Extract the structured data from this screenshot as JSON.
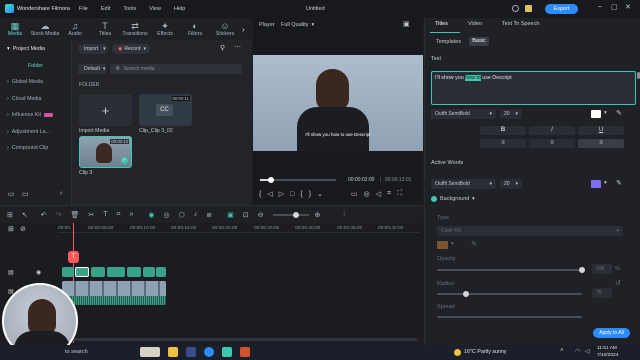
{
  "titlebar": {
    "app_name": "Wondershare Filmora",
    "menus": [
      "File",
      "Edit",
      "Tools",
      "View",
      "Help"
    ],
    "project_title": "Untitled",
    "export_label": "Export"
  },
  "top_tabs": [
    {
      "label": "Media",
      "icon": "media-icon",
      "glyph": "▦"
    },
    {
      "label": "Stock Media",
      "icon": "stock-media-icon",
      "glyph": "☁"
    },
    {
      "label": "Audio",
      "icon": "audio-icon",
      "glyph": "♫"
    },
    {
      "label": "Titles",
      "icon": "titles-icon",
      "glyph": "T"
    },
    {
      "label": "Transitions",
      "icon": "transitions-icon",
      "glyph": "⇄"
    },
    {
      "label": "Effects",
      "icon": "effects-icon",
      "glyph": "✦"
    },
    {
      "label": "Filters",
      "icon": "filters-icon",
      "glyph": "◐"
    },
    {
      "label": "Stickers",
      "icon": "stickers-icon",
      "glyph": "☺"
    }
  ],
  "sidebar": {
    "items": [
      {
        "label": "Project Media"
      },
      {
        "label": "Folder"
      },
      {
        "label": "Global Media"
      },
      {
        "label": "Cloud Media"
      },
      {
        "label": "Influence Kit"
      },
      {
        "label": "Adjustment La..."
      },
      {
        "label": "Compound Clip"
      }
    ]
  },
  "media": {
    "import_label": "Import",
    "record_label": "Record",
    "sort_label": "Default",
    "search_placeholder": "Search media",
    "folder_label": "FOLDER",
    "items": [
      {
        "label": "Import Media"
      },
      {
        "label": "Clip_Clip 3_02",
        "duration": "00:00:11"
      },
      {
        "label": "Clip 3",
        "duration": "00:00:13"
      }
    ]
  },
  "player": {
    "label": "Player",
    "quality": "Full Quality",
    "caption": "I'll show you how to use Descript",
    "current_time": "00:00:02:00",
    "total_time": "00:00:13:01",
    "progress": 0.15
  },
  "right_panel": {
    "tabs": [
      "Titles",
      "Video",
      "Text To Speech"
    ],
    "subtabs": [
      "Templates",
      "Basic"
    ],
    "text_section": "Text",
    "text_value_before": "I'll show you ",
    "text_value_highlight": "how to",
    "text_value_after": " use Descript",
    "font": "Outfit SemiBold",
    "size": "20",
    "format_buttons": [
      "B",
      "I",
      "U"
    ],
    "active_words_section": "Active Words",
    "active_font": "Outfit SemiBold",
    "active_size": "20",
    "active_color": "#7c6cf0",
    "text_color": "#ffffff",
    "background_label": "Background",
    "type_label": "Type",
    "type_value": "Color Fill",
    "opacity_label": "Opacity",
    "opacity_value": "100",
    "opacity_unit": "%",
    "radius_label": "Radius",
    "radius_value": "75",
    "spread_label": "Spread",
    "apply_all_label": "Apply to All"
  },
  "timeline": {
    "ruler": [
      "00:00",
      "00:00:05:00",
      "00:00:10:00",
      "00:00:15:00",
      "00:00:20:00",
      "00:00:25:00",
      "00:00:30:00",
      "00:00:35:00",
      "00:00:40:00"
    ],
    "playhead_label": "T"
  },
  "taskbar": {
    "search_placeholder": "to search",
    "weather": "16°C  Partly sunny",
    "time": "11:51 AM",
    "date": "7/10/2024"
  },
  "colors": {
    "accent": "#3ec8b0",
    "export": "#2a8cff",
    "title_clip": "#3aa287",
    "playhead": "#ff5a5a"
  }
}
